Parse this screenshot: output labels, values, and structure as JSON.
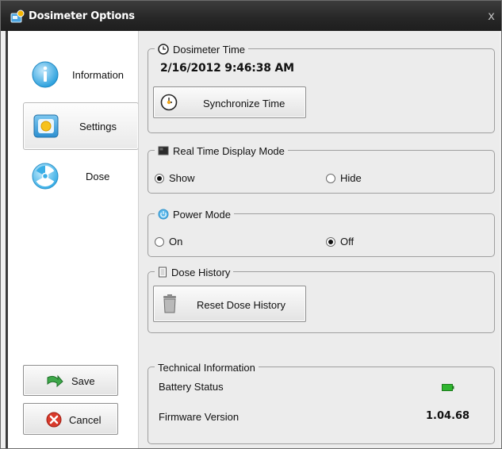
{
  "window": {
    "title": "Dosimeter Options",
    "close_glyph": "x"
  },
  "nav": [
    {
      "label": "Information",
      "icon": "info-icon",
      "selected": false
    },
    {
      "label": "Settings",
      "icon": "settings-icon",
      "selected": true
    },
    {
      "label": "Dose",
      "icon": "radiation-icon",
      "selected": false
    }
  ],
  "actions": {
    "save_label": "Save",
    "cancel_label": "Cancel"
  },
  "dosimeter_time": {
    "title": "Dosimeter Time",
    "value": "2/16/2012 9:46:38 AM",
    "sync_label": "Synchronize Time"
  },
  "realtime_display": {
    "title": "Real Time Display Mode",
    "options": [
      {
        "label": "Show",
        "checked": true
      },
      {
        "label": "Hide",
        "checked": false
      }
    ]
  },
  "power_mode": {
    "title": "Power Mode",
    "options": [
      {
        "label": "On",
        "checked": false
      },
      {
        "label": "Off",
        "checked": true
      }
    ]
  },
  "dose_history": {
    "title": "Dose History",
    "reset_label": "Reset Dose History"
  },
  "technical": {
    "title": "Technical Information",
    "battery_label": "Battery Status",
    "battery_icon": "battery-icon",
    "firmware_label": "Firmware Version",
    "firmware_value": "1.04.68"
  },
  "colors": {
    "titlebar": "#262626",
    "accent_blue": "#2aa7e0",
    "battery_green": "#2fb52f"
  }
}
